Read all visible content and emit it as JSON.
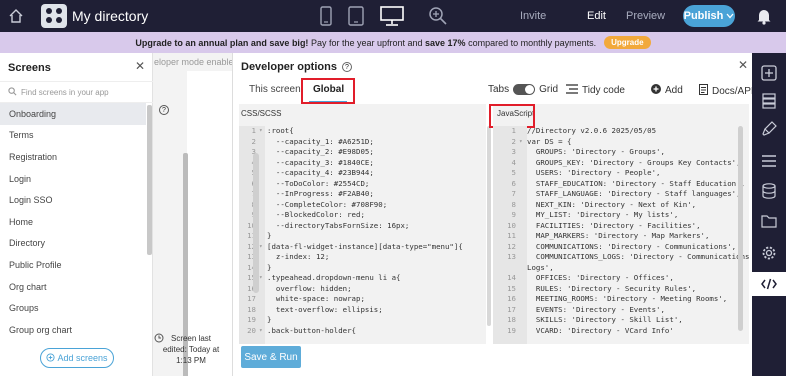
{
  "topbar": {
    "app_title": "My directory",
    "invite": "Invite",
    "edit": "Edit",
    "preview": "Preview",
    "publish": "Publish"
  },
  "promo": {
    "bold1": "Upgrade to an annual plan and save big!",
    "mid": " Pay for the year upfront and ",
    "bold2": "save 17%",
    "end": " compared to monthly payments.",
    "button": "Upgrade"
  },
  "screens": {
    "title": "Screens",
    "search_placeholder": "Find screens in your app",
    "items": [
      "Onboarding",
      "Terms",
      "Registration",
      "Login",
      "Login SSO",
      "Home",
      "Directory",
      "Public Profile",
      "Org chart",
      "Groups",
      "Group org chart"
    ],
    "add_button": "Add screens"
  },
  "behind": {
    "top_text": "eloper mode enable",
    "help": "?",
    "edited_lines": [
      "Screen last",
      "edited: Today at",
      "1:13 PM"
    ]
  },
  "dev": {
    "title": "Developer options",
    "help": "?",
    "tab_this_screen": "This screen",
    "tab_global": "Global",
    "tabs_label": "Tabs",
    "grid_label": "Grid",
    "tidy": "Tidy code",
    "add": "Add",
    "docs": "Docs/API",
    "css_label": "CSS/SCSS",
    "js_label": "JavaScript",
    "save_run": "Save & Run"
  },
  "css_lines": [
    {
      "n": "1",
      "f": "▾",
      "t": ":root{"
    },
    {
      "n": "2",
      "f": "",
      "t": "  --capacity_1: #A6251D;"
    },
    {
      "n": "3",
      "f": "",
      "t": "  --capacity_2: #E98D05;"
    },
    {
      "n": "4",
      "f": "",
      "t": "  --capacity_3: #1840CE;"
    },
    {
      "n": "5",
      "f": "",
      "t": "  --capacity_4: #23B944;"
    },
    {
      "n": "6",
      "f": "",
      "t": "  --ToDoColor: #2554CD;"
    },
    {
      "n": "7",
      "f": "",
      "t": "  --InProgress: #F2AB40;"
    },
    {
      "n": "8",
      "f": "",
      "t": "  --CompleteColor: #708F90;"
    },
    {
      "n": "9",
      "f": "",
      "t": "  --BlockedColor: red;"
    },
    {
      "n": "10",
      "f": "",
      "t": "  --directoryTabsFornSize: 16px;"
    },
    {
      "n": "11",
      "f": "",
      "t": "}"
    },
    {
      "n": "12",
      "f": "▾",
      "t": "[data-fl-widget-instance][data-type=\"menu\"]{"
    },
    {
      "n": "13",
      "f": "",
      "t": "  z-index: 12;"
    },
    {
      "n": "14",
      "f": "",
      "t": "}"
    },
    {
      "n": "15",
      "f": "▾",
      "t": ".typeahead.dropdown-menu li a{"
    },
    {
      "n": "16",
      "f": "",
      "t": "  overflow: hidden;"
    },
    {
      "n": "17",
      "f": "",
      "t": "  white-space: nowrap;"
    },
    {
      "n": "18",
      "f": "",
      "t": "  text-overflow: ellipsis;"
    },
    {
      "n": "19",
      "f": "",
      "t": "}"
    },
    {
      "n": "20",
      "f": "▾",
      "t": ".back-button-holder{"
    }
  ],
  "js_lines": [
    {
      "n": "1",
      "f": "",
      "t": "//Directory v2.0.6 2025/05/05"
    },
    {
      "n": "2",
      "f": "▾",
      "t": "var DS = {"
    },
    {
      "n": "3",
      "f": "",
      "t": "  GROUPS: 'Directory - Groups',"
    },
    {
      "n": "4",
      "f": "",
      "t": "  GROUPS_KEY: 'Directory - Groups Key Contacts',"
    },
    {
      "n": "5",
      "f": "",
      "t": "  USERS: 'Directory - People',"
    },
    {
      "n": "6",
      "f": "",
      "t": "  STAFF_EDUCATION: 'Directory - Staff Education',"
    },
    {
      "n": "7",
      "f": "",
      "t": "  STAFF_LANGUAGE: 'Directory - Staff languages',"
    },
    {
      "n": "8",
      "f": "",
      "t": "  NEXT_KIN: 'Directory - Next of Kin',"
    },
    {
      "n": "9",
      "f": "",
      "t": "  MY_LIST: 'Directory - My lists',"
    },
    {
      "n": "10",
      "f": "",
      "t": "  FACILITIES: 'Directory - Facilities',"
    },
    {
      "n": "11",
      "f": "",
      "t": "  MAP_MARKERS: 'Directory - Map Markers',"
    },
    {
      "n": "12",
      "f": "",
      "t": "  COMMUNICATIONS: 'Directory - Communications',"
    },
    {
      "n": "13",
      "f": "",
      "t": "  COMMUNICATIONS_LOGS: 'Directory - Communications"
    },
    {
      "n": "",
      "f": "",
      "t": "Logs',"
    },
    {
      "n": "14",
      "f": "",
      "t": "  OFFICES: 'Directory - Offices',"
    },
    {
      "n": "15",
      "f": "",
      "t": "  RULES: 'Directory - Security Rules',"
    },
    {
      "n": "16",
      "f": "",
      "t": "  MEETING_ROOMS: 'Directory - Meeting Rooms',"
    },
    {
      "n": "17",
      "f": "",
      "t": "  EVENTS: 'Directory - Events',"
    },
    {
      "n": "18",
      "f": "",
      "t": "  SKILLS: 'Directory - Skill List',"
    },
    {
      "n": "19",
      "f": "",
      "t": "  VCARD: 'Directory - VCard Info'"
    }
  ],
  "colors": {
    "topbar": "#1f1f35",
    "promo": "#d8c9eb",
    "accent": "#4aa3d7",
    "highlight_box": "#e11d2a",
    "upgrade": "#f2a93b"
  }
}
